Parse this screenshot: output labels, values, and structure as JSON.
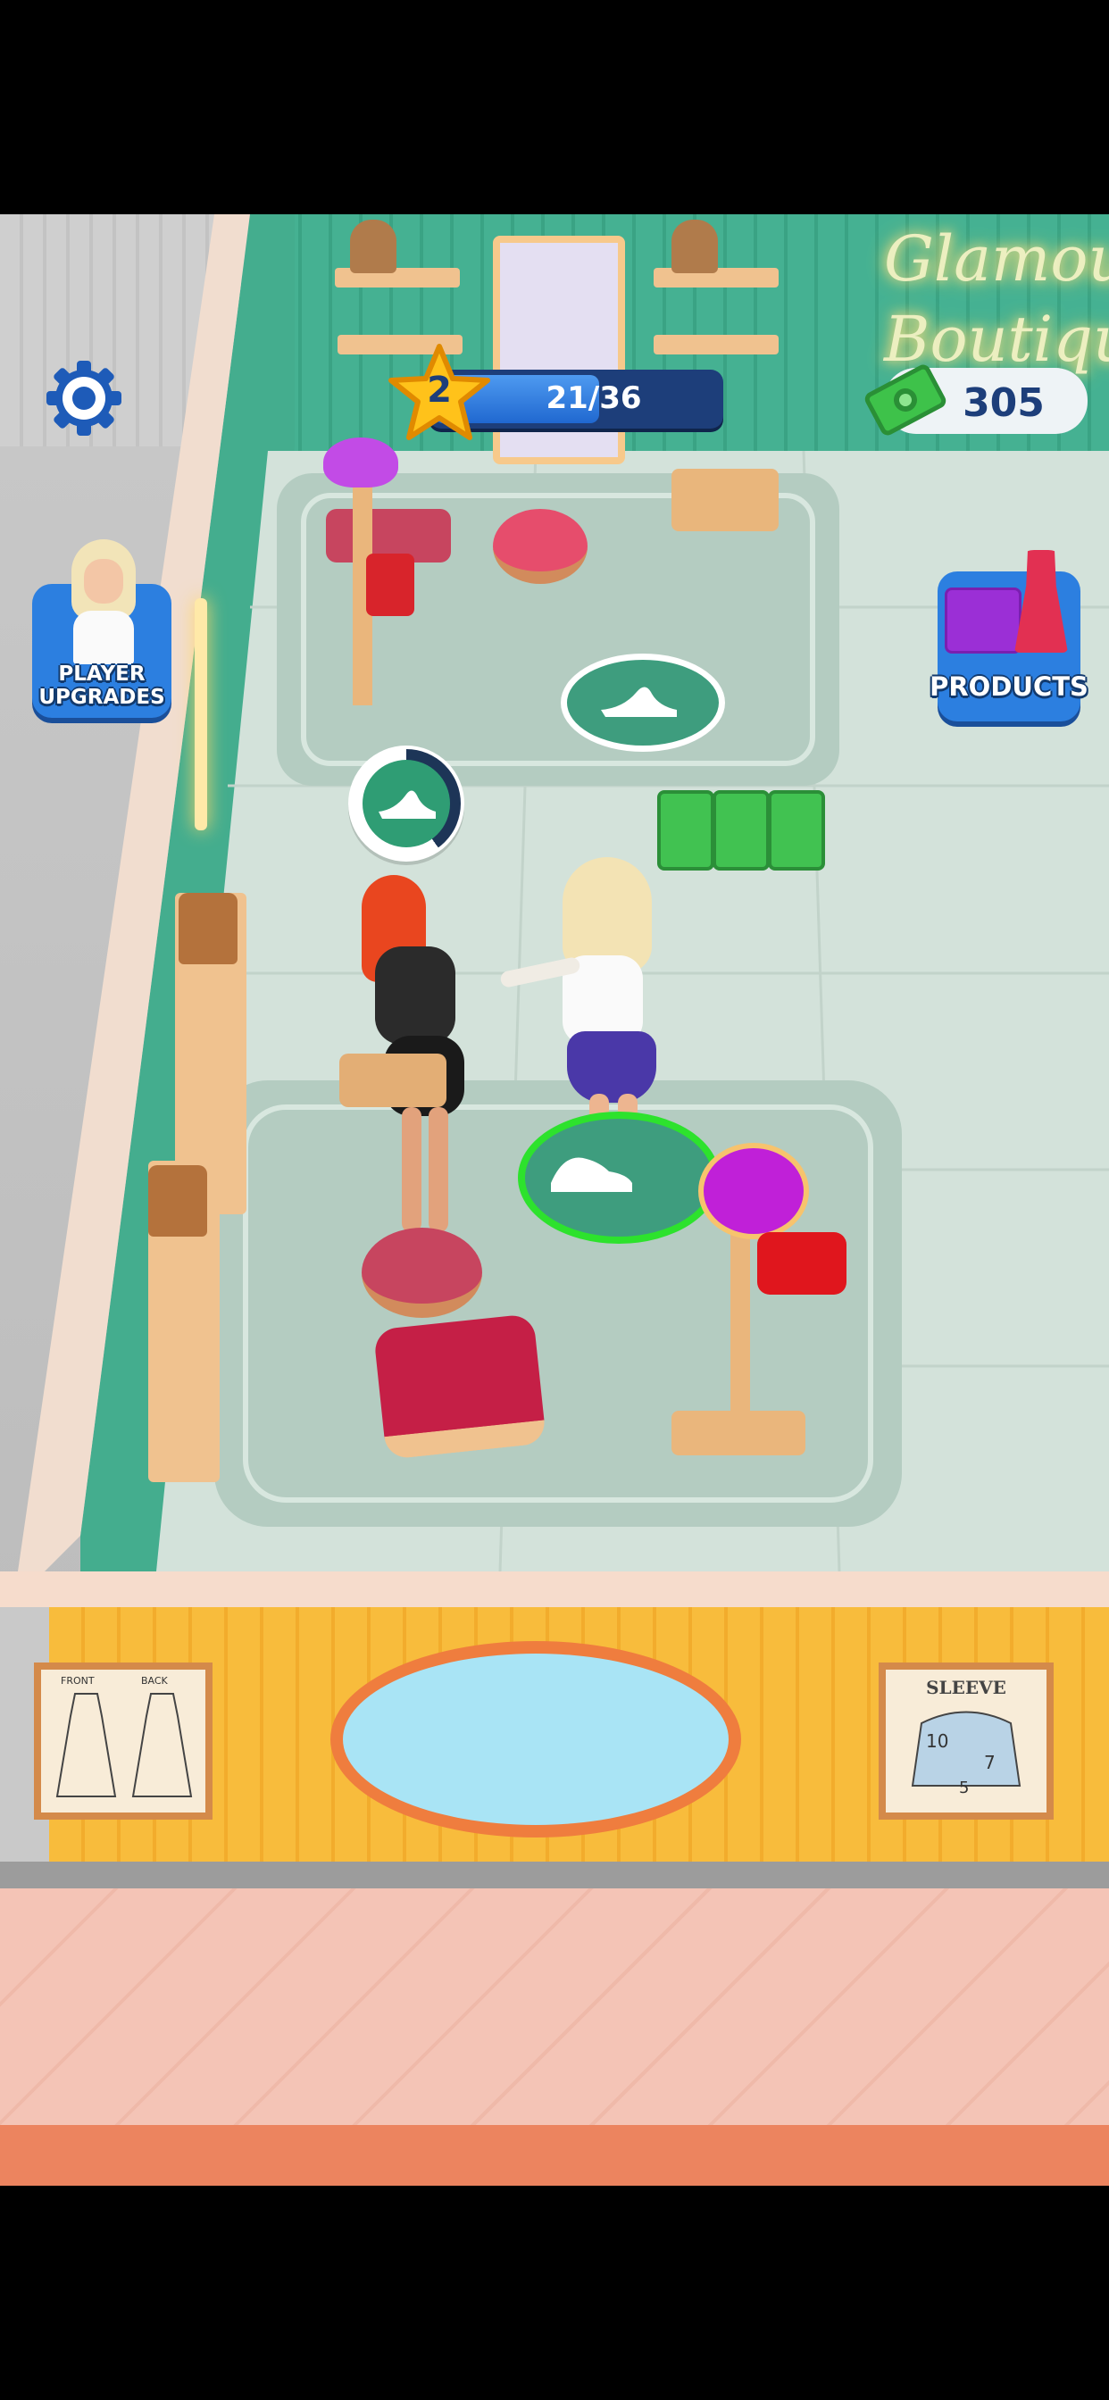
{
  "hud": {
    "level": "2",
    "progress_text": "21/36",
    "progress_fraction": 0.583,
    "cash": "305"
  },
  "buttons": {
    "player_upgrades_line1": "PLAYER",
    "player_upgrades_line2": "UPGRADES",
    "products": "PRODUCTS"
  },
  "scene": {
    "neon_sign_line1": "Glamou",
    "neon_sign_line2": "Boutiqu",
    "sleeve_chart_title": "SLEEVE",
    "sleeve_chart_n1": "10",
    "sleeve_chart_n2": "7",
    "sleeve_chart_n3": "5",
    "dress_chart_front": "FRONT",
    "dress_chart_back": "BACK"
  },
  "colors": {
    "accent_blue": "#1f63c9",
    "cash_green": "#3ec24a",
    "wall_teal": "#3ea98a",
    "floor": "#d5e4dd",
    "wall_yellow": "#f6b83a",
    "pink_ground": "#f3c1b2"
  }
}
